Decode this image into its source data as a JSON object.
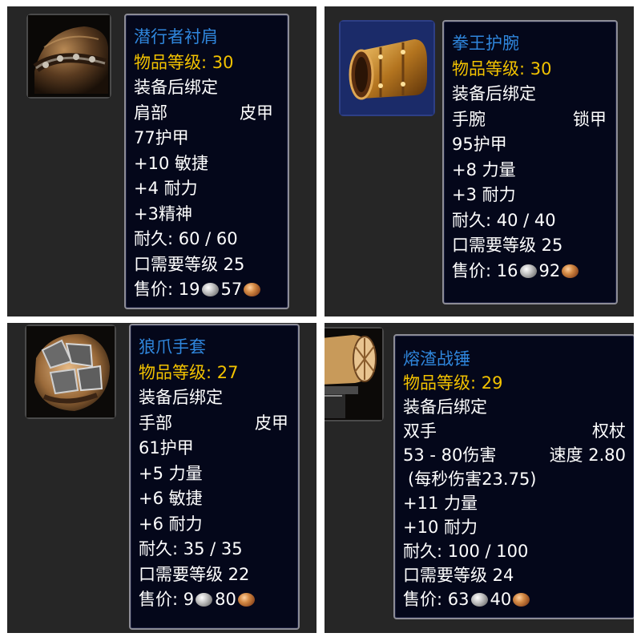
{
  "items": [
    {
      "name": "潜行者衬肩",
      "item_level": "物品等级: 30",
      "bind": "装备后绑定",
      "slot": "肩部",
      "type": "皮甲",
      "stats": [
        "77护甲",
        "+10 敏捷",
        "+4 耐力",
        "+3精神"
      ],
      "durability": "耐久: 60 / 60",
      "requirement": "口需要等级 25",
      "price_label": "售价:",
      "price_silver": "19",
      "price_copper": "57",
      "icon": "leather-shoulder-icon"
    },
    {
      "name": "拳王护腕",
      "item_level": "物品等级: 30",
      "bind": "装备后绑定",
      "slot": "手腕",
      "type": "锁甲",
      "stats": [
        "95护甲",
        "+8 力量",
        "+3 耐力"
      ],
      "durability": "耐久: 40 / 40",
      "requirement": "口需要等级 25",
      "price_label": "售价:",
      "price_silver": "16",
      "price_copper": "92",
      "icon": "bracer-icon"
    },
    {
      "name": "狼爪手套",
      "item_level": "物品等级: 27",
      "bind": "装备后绑定",
      "slot": "手部",
      "type": "皮甲",
      "stats": [
        "61护甲",
        "+5 力量",
        "+6 敏捷",
        "+6 耐力"
      ],
      "durability": "耐久: 35 / 35",
      "requirement": "口需要等级 22",
      "price_label": "售价:",
      "price_silver": "9",
      "price_copper": "80",
      "icon": "claw-glove-icon"
    },
    {
      "name": "熔渣战锤",
      "item_level": "物品等级: 29",
      "bind": "装备后绑定",
      "slot": "双手",
      "type": "权杖",
      "damage": "53 - 80伤害",
      "speed": "速度 2.80",
      "dps": "(每秒伤害23.75)",
      "stats": [
        "+11 力量",
        "+10 耐力"
      ],
      "durability": "耐久: 100 / 100",
      "requirement": "口需要等级 24",
      "price_label": "售价:",
      "price_silver": "63",
      "price_copper": "40",
      "icon": "warhammer-icon"
    }
  ],
  "colors": {
    "title": "#2f86dc",
    "item_level": "#f2c200",
    "tooltip_bg": "#04071a",
    "panel_bg": "#262626"
  }
}
